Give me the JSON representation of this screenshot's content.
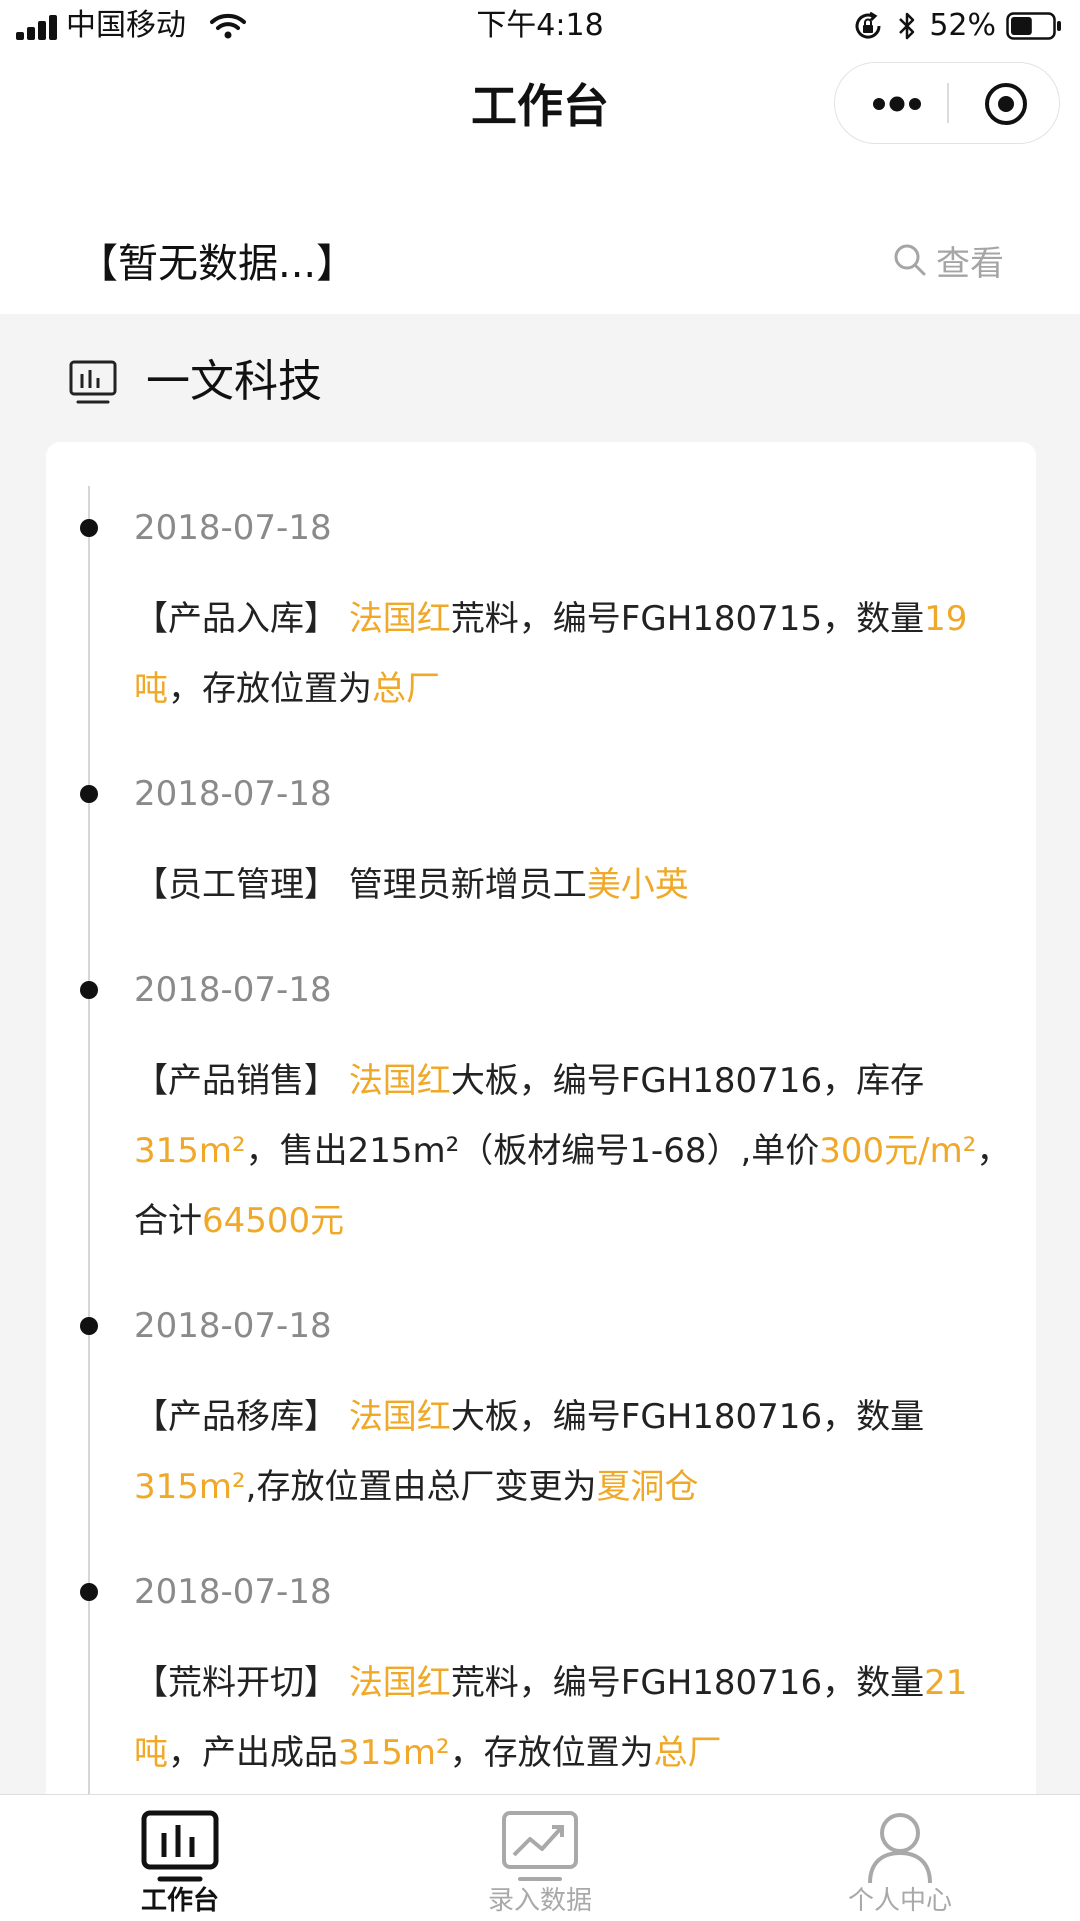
{
  "status_bar": {
    "carrier": "中国移动",
    "time": "下午4:18",
    "battery": "52%",
    "battery_level": 0.52
  },
  "nav": {
    "title": "工作台"
  },
  "search_row": {
    "no_data": "【暂无数据...】",
    "view_label": "查看"
  },
  "section": {
    "title": "一文科技"
  },
  "timeline": [
    {
      "date": "2018-07-18",
      "parts": [
        {
          "t": "【产品入库】 "
        },
        {
          "t": "法国红",
          "hl": true
        },
        {
          "t": "荒料，编号FGH180715，数量"
        },
        {
          "t": "19吨",
          "hl": true
        },
        {
          "t": "，存放位置为"
        },
        {
          "t": "总厂",
          "hl": true
        }
      ]
    },
    {
      "date": "2018-07-18",
      "parts": [
        {
          "t": "【员工管理】 管理员新增员工"
        },
        {
          "t": "美小英",
          "hl": true
        }
      ]
    },
    {
      "date": "2018-07-18",
      "parts": [
        {
          "t": "【产品销售】 "
        },
        {
          "t": "法国红",
          "hl": true
        },
        {
          "t": "大板，编号FGH180716，库存"
        },
        {
          "t": "315m²",
          "hl": true
        },
        {
          "t": "，售出215m²（板材编号1-68）,单价"
        },
        {
          "t": "300元/m²",
          "hl": true
        },
        {
          "t": "，合计"
        },
        {
          "t": "64500元",
          "hl": true
        }
      ]
    },
    {
      "date": "2018-07-18",
      "parts": [
        {
          "t": "【产品移库】 "
        },
        {
          "t": "法国红",
          "hl": true
        },
        {
          "t": "大板，编号FGH180716，数量"
        },
        {
          "t": "315m²",
          "hl": true
        },
        {
          "t": ",存放位置由总厂变更为"
        },
        {
          "t": "夏洞仓",
          "hl": true
        }
      ]
    },
    {
      "date": "2018-07-18",
      "parts": [
        {
          "t": "【荒料开切】 "
        },
        {
          "t": "法国红",
          "hl": true
        },
        {
          "t": "荒料，编号FGH180716，数量"
        },
        {
          "t": "21吨",
          "hl": true
        },
        {
          "t": "，产出成品"
        },
        {
          "t": "315m²",
          "hl": true
        },
        {
          "t": "，存放位置为"
        },
        {
          "t": "总厂",
          "hl": true
        }
      ]
    }
  ],
  "tabs": [
    {
      "label": "工作台",
      "icon": "workbench-icon",
      "active": true
    },
    {
      "label": "录入数据",
      "icon": "data-entry-icon",
      "active": false
    },
    {
      "label": "个人中心",
      "icon": "user-icon",
      "active": false
    }
  ],
  "colors": {
    "highlight": "#f0a829",
    "text": "#222222",
    "muted": "#8a8a8a",
    "background": "#f4f4f4"
  }
}
